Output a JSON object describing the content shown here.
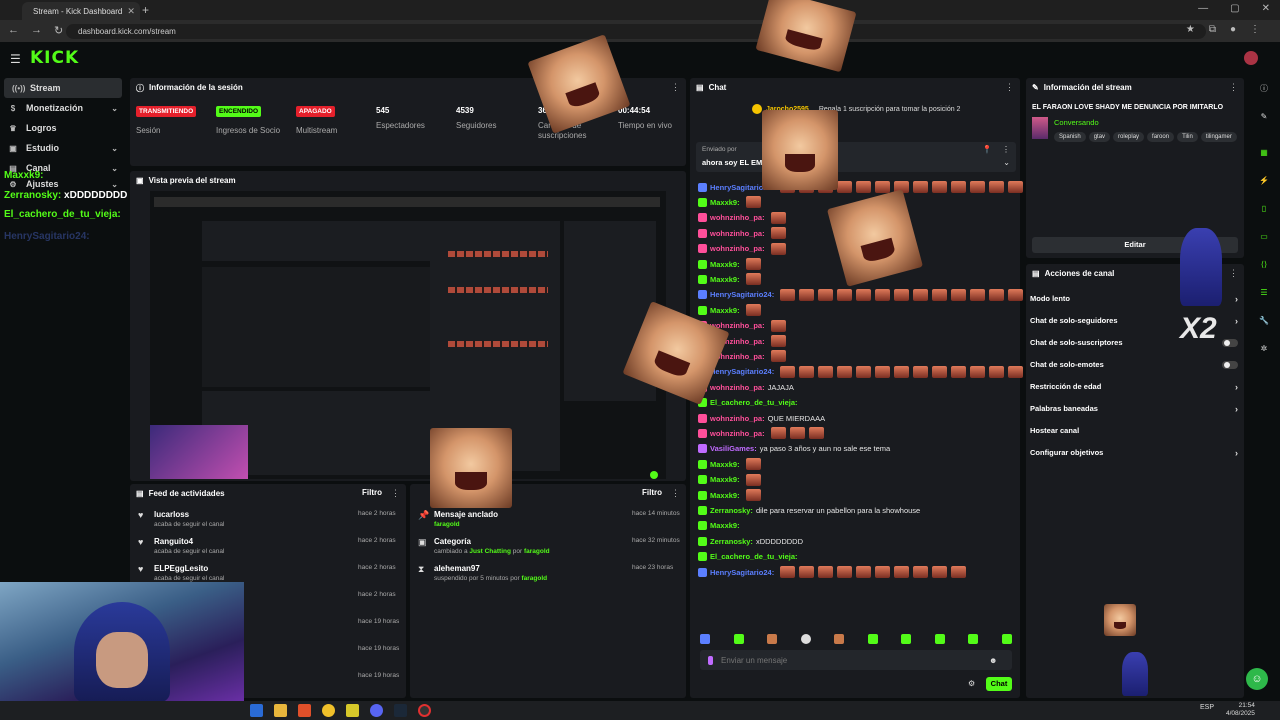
{
  "browser": {
    "tab_title": "Stream - Kick Dashboard",
    "url": "dashboard.kick.com/stream"
  },
  "brand": {
    "logo": "KICK",
    "accent": "#53fc18"
  },
  "sidebar": {
    "items": [
      {
        "label": "Stream",
        "icon": "broadcast-icon"
      },
      {
        "label": "Monetización",
        "icon": "dollar-icon"
      },
      {
        "label": "Logros",
        "icon": "trophy-icon"
      },
      {
        "label": "Estudio",
        "icon": "studio-icon"
      },
      {
        "label": "Canal",
        "icon": "channel-icon"
      },
      {
        "label": "Ajustes",
        "icon": "gear-icon"
      }
    ]
  },
  "session": {
    "title": "Información de la sesión",
    "stats": [
      {
        "badge": "TRANSMITIENDO",
        "label": "Sesión"
      },
      {
        "badge": "ENCENDIDO",
        "label": "Ingresos de Socio"
      },
      {
        "badge": "APAGADO",
        "label": "Multistream"
      },
      {
        "value": "545",
        "label": "Espectadores"
      },
      {
        "value": "4539",
        "label": "Seguidores"
      },
      {
        "value": "36",
        "label": "Cantidad de suscripciones"
      },
      {
        "value": "00:44:54",
        "label": "Tiempo en vivo"
      }
    ]
  },
  "preview": {
    "title": "Vista previa del stream"
  },
  "overlay_chat": [
    {
      "user": "Maxxk9:",
      "text": ""
    },
    {
      "user": "Zerranosky:",
      "text": "xDDDDDDDD"
    },
    {
      "user": "El_cachero_de_tu_vieja:",
      "text": ""
    },
    {
      "user": "HenrySagitario24:",
      "text": ""
    }
  ],
  "feed": {
    "title": "Feed de actividades",
    "filter": "Filtro",
    "items": [
      {
        "name": "lucarloss",
        "sub": "acaba de seguir el canal",
        "time": "hace 2 horas"
      },
      {
        "name": "Ranguito4",
        "sub": "acaba de seguir el canal",
        "time": "hace 2 horas"
      },
      {
        "name": "ELPEggLesito",
        "sub": "acaba de seguir el canal",
        "time": "hace 2 horas"
      },
      {
        "name": "",
        "sub": "",
        "time": "hace 2 horas"
      },
      {
        "name": "",
        "sub": "",
        "time": "hace 19 horas"
      },
      {
        "name": "",
        "sub": "",
        "time": "hace 19 horas"
      },
      {
        "name": "",
        "sub": "",
        "time": "hace 19 horas"
      }
    ]
  },
  "mod": {
    "title": "or",
    "filter": "Filtro",
    "items": [
      {
        "name": "Mensaje anclado",
        "sub_pre": "",
        "sub_user": "faragold",
        "sub_mid": "",
        "sub_user2": "",
        "time": "hace 14 minutos"
      },
      {
        "name": "Categoría",
        "sub_pre": "cambiado a ",
        "sub_user": "Just Chatting",
        "sub_mid": " por ",
        "sub_user2": "faragold",
        "time": "hace 32 minutos"
      },
      {
        "name": "aleheman97",
        "sub_pre": "suspendido por 5 minutos por ",
        "sub_user": "faragold",
        "sub_mid": "",
        "sub_user2": "",
        "time": "hace 23 horas"
      }
    ]
  },
  "chat": {
    "title": "Chat",
    "top_user": "Jarocho2595",
    "top_text": "Regala 1 suscripción para tomar la posición 2",
    "pinned_label": "Enviado por",
    "pinned_text": "ahora soy EL EMPI",
    "messages": [
      {
        "user": "HenrySagitario24:",
        "color": "#5b7fff",
        "text": "",
        "emotes": 18
      },
      {
        "user": "Maxxk9:",
        "color": "#53fc18",
        "text": "",
        "emotes": 1
      },
      {
        "user": "wohnzinho_pa:",
        "color": "#ff4f9a",
        "text": "",
        "emotes": 1
      },
      {
        "user": "wohnzinho_pa:",
        "color": "#ff4f9a",
        "text": "",
        "emotes": 1
      },
      {
        "user": "wohnzinho_pa:",
        "color": "#ff4f9a",
        "text": "",
        "emotes": 1
      },
      {
        "user": "Maxxk9:",
        "color": "#53fc18",
        "text": "",
        "emotes": 1
      },
      {
        "user": "Maxxk9:",
        "color": "#53fc18",
        "text": "",
        "emotes": 1
      },
      {
        "user": "HenrySagitario24:",
        "color": "#5b7fff",
        "text": "",
        "emotes": 18
      },
      {
        "user": "Maxxk9:",
        "color": "#53fc18",
        "text": "",
        "emotes": 1
      },
      {
        "user": "wohnzinho_pa:",
        "color": "#ff4f9a",
        "text": "",
        "emotes": 1
      },
      {
        "user": "wohnzinho_pa:",
        "color": "#ff4f9a",
        "text": "",
        "emotes": 1
      },
      {
        "user": "wohnzinho_pa:",
        "color": "#ff4f9a",
        "text": "",
        "emotes": 1
      },
      {
        "user": "HenrySagitario24:",
        "color": "#5b7fff",
        "text": "",
        "emotes": 18
      },
      {
        "user": "wohnzinho_pa:",
        "color": "#ff4f9a",
        "text": "JAJAJA",
        "emotes": 0
      },
      {
        "user": "El_cachero_de_tu_vieja:",
        "color": "#53fc18",
        "text": "",
        "emotes": 0
      },
      {
        "user": "wohnzinho_pa:",
        "color": "#ff4f9a",
        "text": "QUE MIERDAAA",
        "emotes": 0
      },
      {
        "user": "wohnzinho_pa:",
        "color": "#ff4f9a",
        "text": "",
        "emotes": 3
      },
      {
        "user": "VasiliGames:",
        "color": "#c06bff",
        "text": "ya paso 3 años y aun no sale ese tema",
        "emotes": 0
      },
      {
        "user": "Maxxk9:",
        "color": "#53fc18",
        "text": "",
        "emotes": 1
      },
      {
        "user": "Maxxk9:",
        "color": "#53fc18",
        "text": "",
        "emotes": 1
      },
      {
        "user": "Maxxk9:",
        "color": "#53fc18",
        "text": "",
        "emotes": 1
      },
      {
        "user": "Zerranosky:",
        "color": "#53fc18",
        "text": "dile para reservar un pabellon para la showhouse",
        "emotes": 0
      },
      {
        "user": "Maxxk9:",
        "color": "#53fc18",
        "text": "",
        "emotes": 0
      },
      {
        "user": "Zerranosky:",
        "color": "#53fc18",
        "text": "xDDDDDDDD",
        "emotes": 0
      },
      {
        "user": "El_cachero_de_tu_vieja:",
        "color": "#53fc18",
        "text": "",
        "emotes": 0
      },
      {
        "user": "HenrySagitario24:",
        "color": "#5b7fff",
        "text": "",
        "emotes": 10
      }
    ],
    "input_placeholder": "Enviar un mensaje",
    "send_label": "Chat"
  },
  "stream_info": {
    "title": "Información del stream",
    "stream_title": "EL FARAON LOVE SHADY ME DENUNCIA POR IMITARLO",
    "category": "Conversando",
    "tags": [
      "Spanish",
      "gtav",
      "roleplay",
      "faroon",
      "Tilin",
      "tilingamer"
    ],
    "edit_label": "Editar"
  },
  "channel_actions": {
    "title": "Acciones de canal",
    "items": [
      {
        "label": "Modo lento",
        "control": "chevron"
      },
      {
        "label": "Chat de solo-seguidores",
        "control": "chevron"
      },
      {
        "label": "Chat de solo-suscriptores",
        "control": "toggle"
      },
      {
        "label": "Chat de solo-emotes",
        "control": "toggle"
      },
      {
        "label": "Restricción de edad",
        "control": "chevron"
      },
      {
        "label": "Palabras baneadas",
        "control": "chevron"
      },
      {
        "label": "Hostear canal",
        "control": "none"
      },
      {
        "label": "Configurar objetivos",
        "control": "chevron"
      }
    ]
  },
  "overlay_badge": "X2",
  "taskbar": {
    "lang": "ESP",
    "time": "21:54",
    "date": "4/08/2025"
  }
}
